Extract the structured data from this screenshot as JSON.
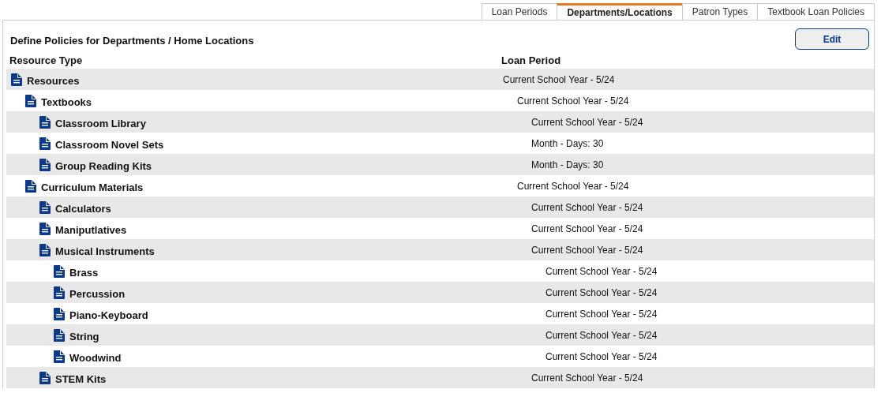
{
  "tabs": [
    {
      "label": "Loan Periods",
      "selected": false
    },
    {
      "label": "Departments/Locations",
      "selected": true
    },
    {
      "label": "Patron Types",
      "selected": false
    },
    {
      "label": "Textbook Loan Policies",
      "selected": false
    }
  ],
  "title": "Define Policies for Departments / Home Locations",
  "edit_button": "Edit",
  "table": {
    "columns": [
      "Resource Type",
      "Loan Period"
    ],
    "rows": [
      {
        "name": "Resources",
        "loan_period": "Current School Year - 5/24",
        "children": [
          {
            "name": "Textbooks",
            "loan_period": "Current School Year - 5/24",
            "children": [
              {
                "name": "Classroom Library",
                "loan_period": "Current School Year - 5/24"
              },
              {
                "name": "Classroom Novel Sets",
                "loan_period": "Month - Days: 30"
              },
              {
                "name": "Group Reading Kits",
                "loan_period": "Month - Days: 30"
              }
            ]
          },
          {
            "name": "Curriculum Materials",
            "loan_period": "Current School Year - 5/24",
            "children": [
              {
                "name": "Calculators",
                "loan_period": "Current School Year - 5/24"
              },
              {
                "name": "Maniputlatives",
                "loan_period": "Current School Year - 5/24"
              },
              {
                "name": "Musical Instruments",
                "loan_period": "Current School Year - 5/24",
                "children": [
                  {
                    "name": "Brass",
                    "loan_period": "Current School Year - 5/24"
                  },
                  {
                    "name": "Percussion",
                    "loan_period": "Current School Year - 5/24"
                  },
                  {
                    "name": "Piano-Keyboard",
                    "loan_period": "Current School Year - 5/24"
                  },
                  {
                    "name": "String",
                    "loan_period": "Current School Year - 5/24"
                  },
                  {
                    "name": "Woodwind",
                    "loan_period": "Current School Year - 5/24"
                  }
                ]
              },
              {
                "name": "STEM Kits",
                "loan_period": "Current School Year - 5/24"
              }
            ]
          }
        ]
      }
    ]
  }
}
